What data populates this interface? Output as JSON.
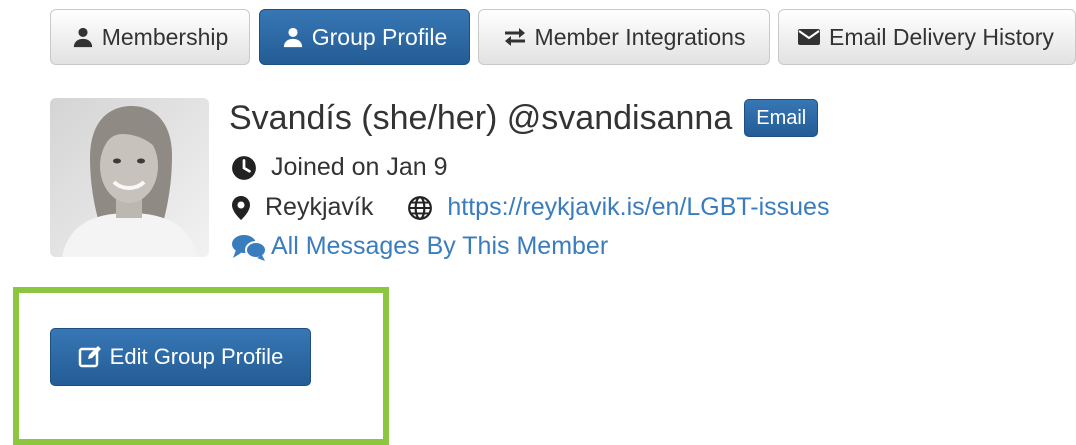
{
  "tabs": [
    {
      "label": "Membership",
      "icon": "user-icon",
      "active": false
    },
    {
      "label": "Group Profile",
      "icon": "user-icon",
      "active": true
    },
    {
      "label": "Member Integrations",
      "icon": "exchange-icon",
      "active": false
    },
    {
      "label": "Email Delivery History",
      "icon": "envelope-icon",
      "active": false
    }
  ],
  "profile": {
    "display_name": "Svandís (she/her) @svandisanna",
    "email_badge": "Email",
    "joined": "Joined on Jan 9",
    "location": "Reykjavík",
    "website": "https://reykjavik.is/en/LGBT-issues",
    "messages_link": "All Messages By This Member"
  },
  "actions": {
    "edit_profile_label": "Edit Group Profile"
  },
  "colors": {
    "primary": "#2d6aa8",
    "link": "#3a7dbf",
    "highlight": "#8cc63f"
  }
}
